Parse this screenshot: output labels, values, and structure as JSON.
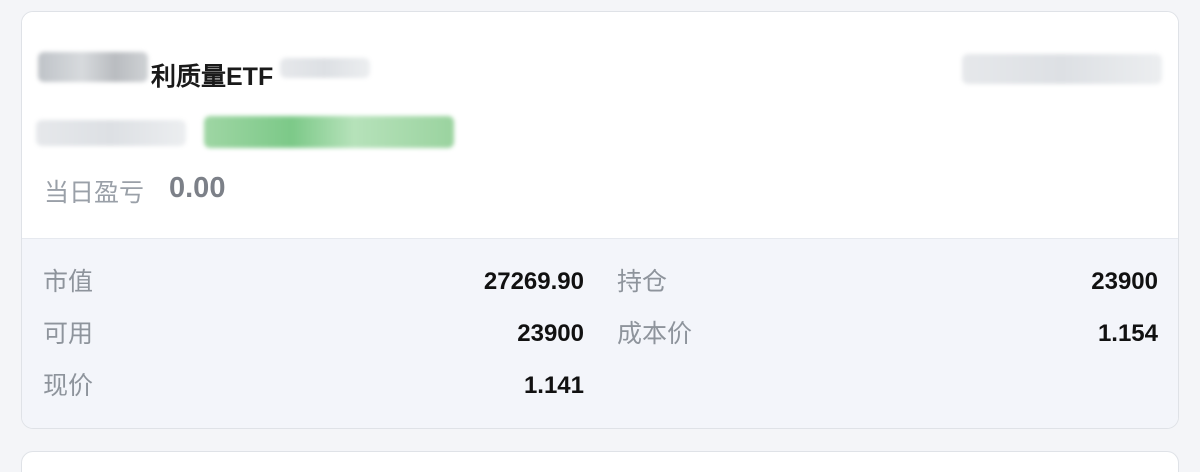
{
  "holding": {
    "name_suffix": "利质量ETF",
    "daily_pnl_label": "当日盈亏",
    "daily_pnl_value": "0.00"
  },
  "stats": {
    "market_value_label": "市值",
    "market_value": "27269.90",
    "position_label": "持仓",
    "position": "23900",
    "available_label": "可用",
    "available": "23900",
    "cost_label": "成本价",
    "cost": "1.154",
    "price_label": "现价",
    "price": "1.141"
  }
}
